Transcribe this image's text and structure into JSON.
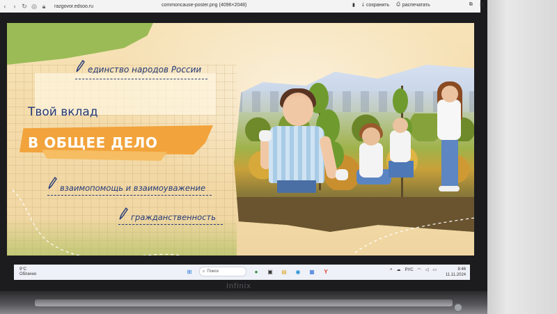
{
  "browser": {
    "address": "razgovor.edsoo.ru",
    "tab_title": "commoncause-poster.png (4096×2048)",
    "save_label": "сохранить",
    "print_label": "распечатать"
  },
  "poster": {
    "tag_unity": "единство народов России",
    "title_line1": "Твой вклад",
    "title_line2": "В ОБЩЕЕ ДЕЛО",
    "tag_mutual": "взаимопомощь и взаимоуважение",
    "tag_citizenship": "гражданственность"
  },
  "taskbar": {
    "weather_temp": "9°C",
    "weather_desc": "Облачно",
    "search_placeholder": "Поиск",
    "language": "РУС",
    "time": "8:46",
    "date": "11.11.2024"
  },
  "laptop": {
    "brand": "Infinix"
  },
  "colors": {
    "accent_orange": "#f2a33b",
    "navy_text": "#243a78",
    "green": "#9bbb56"
  }
}
